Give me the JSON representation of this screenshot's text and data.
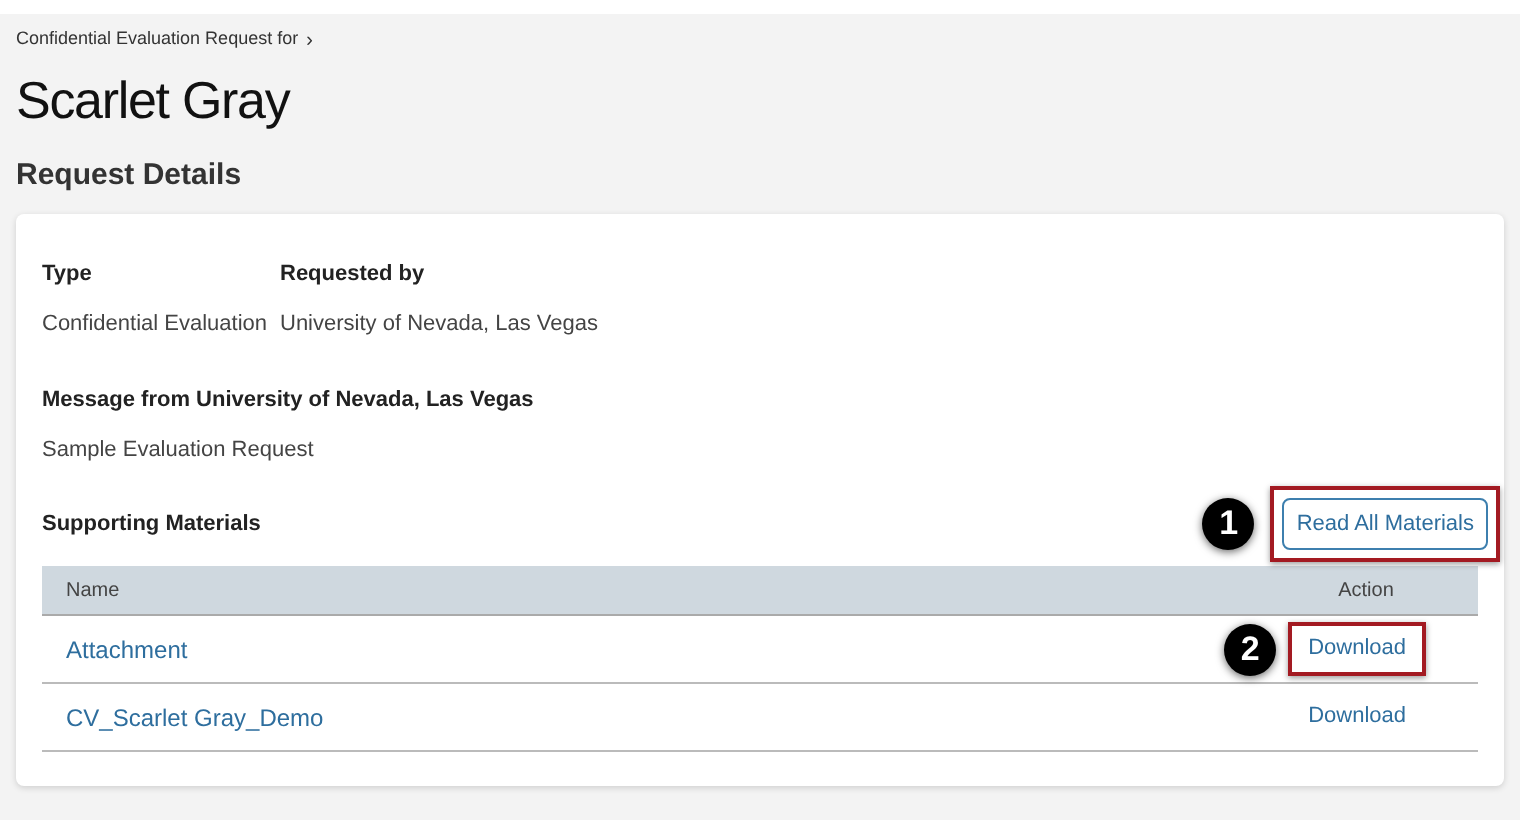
{
  "breadcrumb": {
    "label": "Confidential Evaluation Request for",
    "separator": "›"
  },
  "title": "Scarlet Gray",
  "section_title": "Request Details",
  "details": [
    {
      "label": "Type",
      "value": "Confidential Evaluation"
    },
    {
      "label": "Requested by",
      "value": "University of Nevada, Las Vegas"
    }
  ],
  "message": {
    "label": "Message from University of Nevada, Las Vegas",
    "value": "Sample Evaluation Request"
  },
  "materials": {
    "label": "Supporting Materials",
    "button": {
      "label": "Read All Materials",
      "callout": "1"
    },
    "columns": [
      "Name",
      "Action"
    ],
    "rows": [
      {
        "name": "Attachment",
        "action": "Download",
        "callout": "2"
      },
      {
        "name": "CV_Scarlet Gray_Demo",
        "action": "Download"
      }
    ]
  }
}
